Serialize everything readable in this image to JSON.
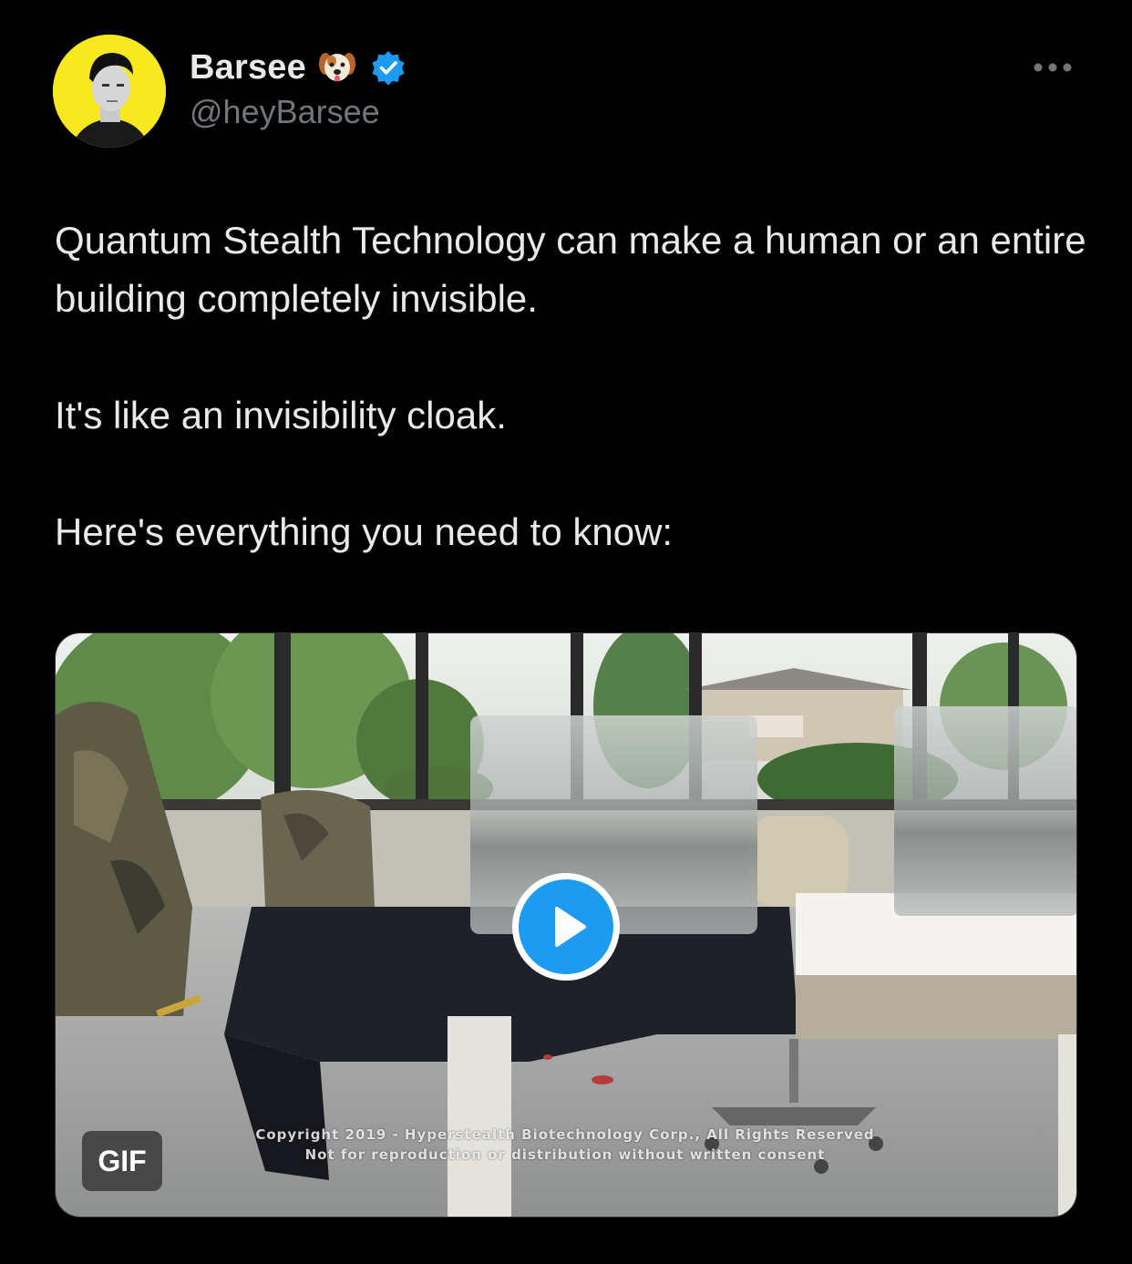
{
  "author": {
    "display_name": "Barsee",
    "handle": "@heyBarsee",
    "emoji_icon": "dog-face-icon",
    "verified_icon": "verified-badge-icon",
    "avatar_bg": "#f7e81f"
  },
  "menu": {
    "icon": "more-options-icon"
  },
  "tweet": {
    "paragraphs": [
      "Quantum Stealth Technology can make a human or an entire building completely invisible.",
      "It's like an invisibility cloak.",
      "Here's everything you need to know:"
    ]
  },
  "media": {
    "badge": "GIF",
    "play_icon": "play-icon",
    "copyright_line1": "Copyright 2019 - Hyperstealth Biotechnology Corp., All Rights Reserved",
    "copyright_line2": "Not for reproduction or distribution without written consent"
  },
  "colors": {
    "background": "#000000",
    "text": "#e7e9ea",
    "secondary": "#71767b",
    "accent": "#1d9bf0"
  }
}
